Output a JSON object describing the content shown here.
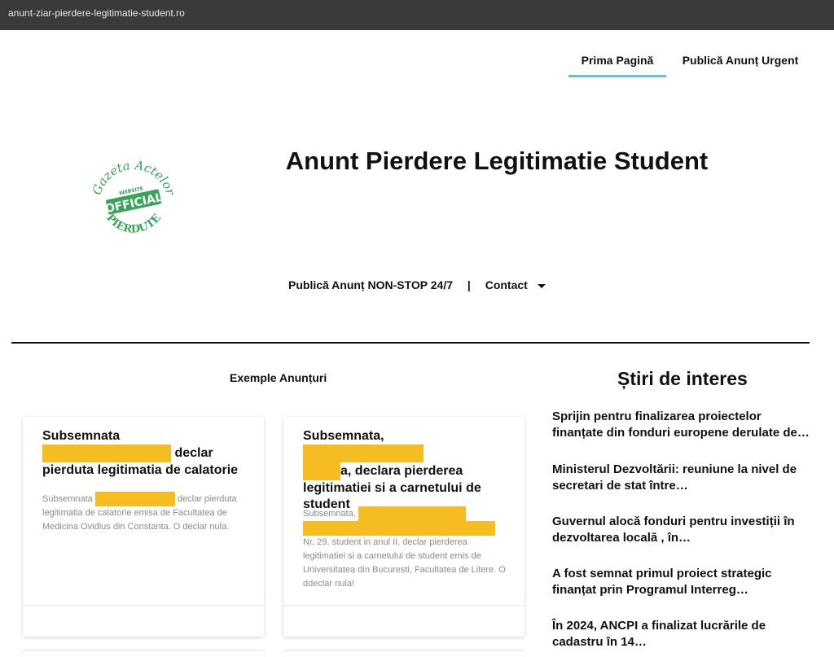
{
  "browser": {
    "url": "anunt-ziar-pierdere-legitimatie-student.ro"
  },
  "nav": {
    "home": "Prima Pagină",
    "urgent": "Publică Anunț Urgent"
  },
  "header": {
    "title": "Anunt Pierdere Legitimatie Student"
  },
  "logo": {
    "arc_top": "Gazeta Actelor",
    "ribbon": "OFFICIAL",
    "ribbon_small": "WEBSITE",
    "arc_bottom": "PIERDUTE"
  },
  "subnav": {
    "publish": "Publică Anunț NON-STOP 24/7",
    "separator": "|",
    "contact": "Contact"
  },
  "sections": {
    "examples": "Exemple Anunțuri",
    "news": "Știri de interes"
  },
  "cards": [
    {
      "title_a": "Subsemnata",
      "title_b": "declar pierduta legitimatia de calatorie",
      "body_a": "Subsemnata",
      "body_b": "declar pierduta legitimatia de calatorie emisa de Facultatea de Medicina Ovidius din Constanta. O declar nula."
    },
    {
      "title_a": "Subsemnata,",
      "title_b": "a, declara pierderea legitimatiei si a carnetului de student",
      "body_a": "Subsemnata,",
      "body_b": "Nr. 29, student in anul II, declar pierderea legitimatiei si a carnetului de student emis de Universitatea din Bucuresti, Facultatea de Litere. O ddeclar nula!"
    }
  ],
  "news": [
    "Sprijin pentru finalizarea proiectelor finanțate din fonduri europene derulate de…",
    "Ministerul Dezvoltării: reuniune la nivel de secretari de stat între…",
    "Guvernul alocă fonduri pentru investiții în dezvoltarea locală , în…",
    "A fost semnat primul proiect strategic finanțat prin Programul Interreg…",
    "În 2024, ANCPI a finalizat lucrările de cadastru în 14…"
  ],
  "colors": {
    "accent": "#67c0e6",
    "redaction": "#f5bd21",
    "logo_green": "#3aa35a",
    "topbar": "#3a3a3a"
  }
}
